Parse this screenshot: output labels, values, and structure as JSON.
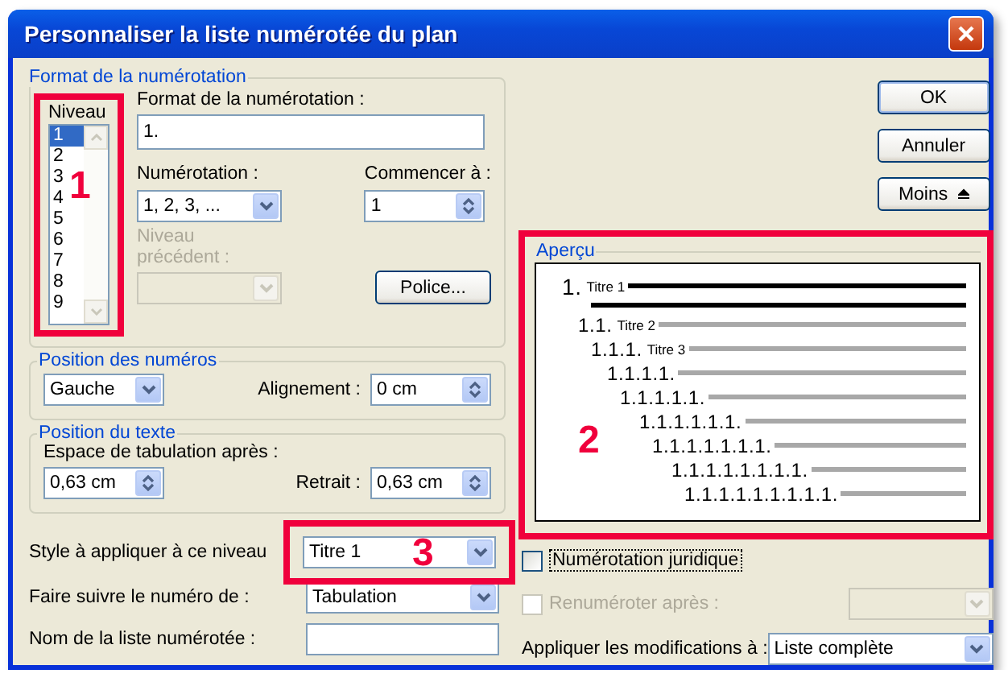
{
  "window": {
    "title": "Personnaliser la liste numérotée du plan"
  },
  "numbering_format": {
    "legend": "Format de la numérotation",
    "level_label": "Niveau",
    "levels": [
      {
        "label": "1",
        "selected": true
      },
      {
        "label": "2",
        "selected": false
      },
      {
        "label": "3",
        "selected": false
      },
      {
        "label": "4",
        "selected": false
      },
      {
        "label": "5",
        "selected": false
      },
      {
        "label": "6",
        "selected": false
      },
      {
        "label": "7",
        "selected": false
      },
      {
        "label": "8",
        "selected": false
      },
      {
        "label": "9",
        "selected": false
      }
    ],
    "format_label": "Format de la numérotation :",
    "format_value": "1.",
    "style_label": "Numérotation :",
    "style_value": "1, 2, 3, ...",
    "start_label": "Commencer à :",
    "start_value": "1",
    "previous_level_label": "Niveau précédent :",
    "previous_level_disabled": true,
    "font_button": "Police..."
  },
  "number_position": {
    "legend": "Position des numéros",
    "alignment_value": "Gauche",
    "offset_label": "Alignement :",
    "offset_value": "0 cm"
  },
  "text_position": {
    "legend": "Position du texte",
    "tab_label": "Espace de tabulation après :",
    "tab_value": "0,63 cm",
    "indent_label": "Retrait :",
    "indent_value": "0,63 cm"
  },
  "style_label": "Style à appliquer à ce niveau",
  "style_value": "Titre 1",
  "follow_label": "Faire suivre le numéro de :",
  "follow_value": "Tabulation",
  "list_name_label": "Nom de la liste numérotée :",
  "buttons": [
    {
      "label": "OK",
      "kind": "default"
    },
    {
      "label": "Annuler",
      "kind": "plain"
    },
    {
      "label": "Moins",
      "kind": "collapse"
    }
  ],
  "preview": {
    "legend": "Aperçu",
    "rows": [
      {
        "number": "1.",
        "title": "Titre 1",
        "kind": "heavy"
      },
      {
        "number": "1.1.",
        "title": "Titre 2",
        "kind": "light"
      },
      {
        "number": "1.1.1.",
        "title": "Titre 3",
        "kind": "light"
      },
      {
        "number": "1.1.1.1.",
        "kind": "light"
      },
      {
        "number": "1.1.1.1.1.",
        "kind": "light"
      },
      {
        "number": "1.1.1.1.1.1.",
        "kind": "light"
      },
      {
        "number": "1.1.1.1.1.1.1.",
        "kind": "light"
      },
      {
        "number": "1.1.1.1.1.1.1.1.",
        "kind": "light"
      },
      {
        "number": "1.1.1.1.1.1.1.1.1.",
        "kind": "light"
      }
    ]
  },
  "legal_numbering": {
    "label": "Numérotation juridique",
    "checked": false
  },
  "restart": {
    "label": "Renuméroter après :",
    "checked": false,
    "disabled": true
  },
  "apply": {
    "label": "Appliquer les modifications à :",
    "value": "Liste complète"
  },
  "annotations": [
    {
      "label": "1"
    },
    {
      "label": "2"
    },
    {
      "label": "3"
    }
  ]
}
